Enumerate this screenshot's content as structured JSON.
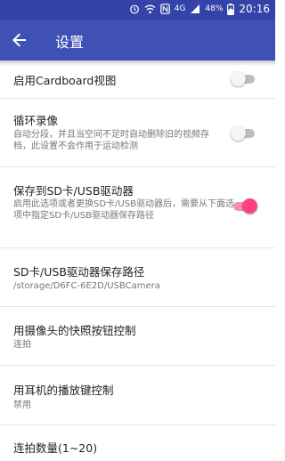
{
  "status_bar": {
    "network": "4G",
    "battery_percent": "48%",
    "time": "20:16"
  },
  "app_bar": {
    "title": "设置",
    "back_icon": "arrow-back-icon"
  },
  "colors": {
    "app_bar": "#3f51b5",
    "status_bar": "#3443a8",
    "accent": "#ff4081"
  },
  "settings": [
    {
      "title": "启用Cardboard视图",
      "subtitle": "",
      "switch": false
    },
    {
      "title": "循环录像",
      "subtitle": "自动分段，并且当空间不足时自动删除旧的视频存档，此设置不会作用于运动检测",
      "switch": false
    },
    {
      "title": "保存到SD卡/USB驱动器",
      "subtitle": "启用此选项或者更换SD卡/USB驱动器后，需要从下面选项中指定SD卡/USB驱动器保存路径",
      "switch": true
    },
    {
      "title": "SD卡/USB驱动器保存路径",
      "subtitle": "/storage/D6FC-6E2D/USBCamera"
    },
    {
      "title": "用摄像头的快照按钮控制",
      "subtitle": "连拍"
    },
    {
      "title": "用耳机的播放键控制",
      "subtitle": "禁用"
    },
    {
      "title": "连拍数量(1~20)",
      "subtitle": ""
    }
  ]
}
